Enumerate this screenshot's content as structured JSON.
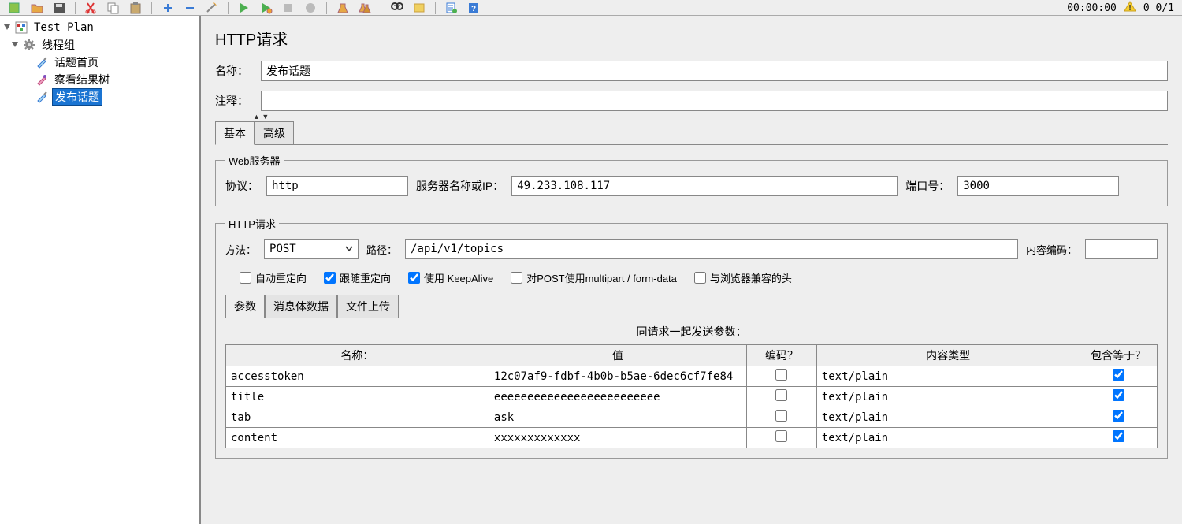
{
  "status": {
    "timer": "00:00:00",
    "run_count": "0  0/1"
  },
  "tree": {
    "root": "Test Plan",
    "thread_group": "线程组",
    "nodes": [
      "话题首页",
      "察看结果树",
      "发布话题"
    ],
    "selected": 2
  },
  "panel": {
    "title": "HTTP请求",
    "name_label": "名称：",
    "name_value": "发布话题",
    "comment_label": "注释：",
    "comment_value": ""
  },
  "tabs": {
    "basic": "基本",
    "advanced": "高级"
  },
  "web_server": {
    "legend": "Web服务器",
    "protocol_label": "协议：",
    "protocol_value": "http",
    "server_label": "服务器名称或IP：",
    "server_value": "49.233.108.117",
    "port_label": "端口号：",
    "port_value": "3000"
  },
  "http_req": {
    "legend": "HTTP请求",
    "method_label": "方法：",
    "method_value": "POST",
    "path_label": "路径：",
    "path_value": "/api/v1/topics",
    "enc_label": "内容编码：",
    "enc_value": ""
  },
  "checkboxes": {
    "auto_redirect": "自动重定向",
    "follow_redirect": "跟随重定向",
    "keepalive": "使用 KeepAlive",
    "multipart": "对POST使用multipart / form-data",
    "browser_compat": "与浏览器兼容的头"
  },
  "inner_tabs": {
    "params": "参数",
    "body": "消息体数据",
    "file": "文件上传"
  },
  "params_section": {
    "caption": "同请求一起发送参数：",
    "headers": {
      "name": "名称：",
      "value": "值",
      "encode": "编码？",
      "ctype": "内容类型",
      "include": "包含等于？"
    },
    "rows": [
      {
        "name": "accesstoken",
        "value": "12c07af9-fdbf-4b0b-b5ae-6dec6cf7fe84",
        "encode": false,
        "ctype": "text/plain",
        "include": true
      },
      {
        "name": "title",
        "value": "eeeeeeeeeeeeeeeeeeeeeeeee",
        "encode": false,
        "ctype": "text/plain",
        "include": true
      },
      {
        "name": "tab",
        "value": "ask",
        "encode": false,
        "ctype": "text/plain",
        "include": true
      },
      {
        "name": "content",
        "value": "xxxxxxxxxxxxx",
        "encode": false,
        "ctype": "text/plain",
        "include": true
      }
    ]
  }
}
